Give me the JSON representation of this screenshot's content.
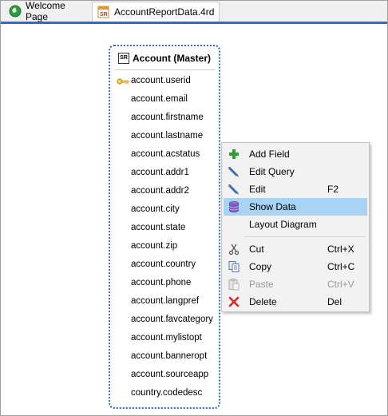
{
  "tabs": [
    {
      "label": "Welcome Page",
      "icon": "globe-icon",
      "active": false
    },
    {
      "label": "AccountReportData.4rd",
      "icon": "report-file-icon",
      "active": true
    }
  ],
  "entity": {
    "title": "Account (Master)",
    "icon_text": "SR",
    "fields": [
      "account.userid",
      "account.email",
      "account.firstname",
      "account.lastname",
      "account.acstatus",
      "account.addr1",
      "account.addr2",
      "account.city",
      "account.state",
      "account.zip",
      "account.country",
      "account.phone",
      "account.langpref",
      "account.favcategory",
      "account.mylistopt",
      "account.banneropt",
      "account.sourceapp",
      "country.codedesc"
    ],
    "key_field": "account.userid"
  },
  "context_menu": {
    "items": [
      {
        "label": "Add Field",
        "shortcut": "",
        "icon": "add-icon",
        "enabled": true,
        "highlighted": false
      },
      {
        "label": "Edit Query",
        "shortcut": "",
        "icon": "edit-query-icon",
        "enabled": true,
        "highlighted": false
      },
      {
        "label": "Edit",
        "shortcut": "F2",
        "icon": "edit-icon",
        "enabled": true,
        "highlighted": false
      },
      {
        "label": "Show Data",
        "shortcut": "",
        "icon": "database-icon",
        "enabled": true,
        "highlighted": true
      },
      {
        "label": "Layout Diagram",
        "shortcut": "",
        "icon": "",
        "enabled": true,
        "highlighted": false
      },
      {
        "label": "Cut",
        "shortcut": "Ctrl+X",
        "icon": "scissors-icon",
        "enabled": true,
        "highlighted": false
      },
      {
        "label": "Copy",
        "shortcut": "Ctrl+C",
        "icon": "copy-icon",
        "enabled": true,
        "highlighted": false
      },
      {
        "label": "Paste",
        "shortcut": "Ctrl+V",
        "icon": "paste-icon",
        "enabled": false,
        "highlighted": false
      },
      {
        "label": "Delete",
        "shortcut": "Del",
        "icon": "delete-icon",
        "enabled": true,
        "highlighted": false
      }
    ]
  },
  "colors": {
    "accent": "#2b6cc4",
    "menu_highlight": "#a8d3f3",
    "disabled_text": "#9b9b9b"
  }
}
